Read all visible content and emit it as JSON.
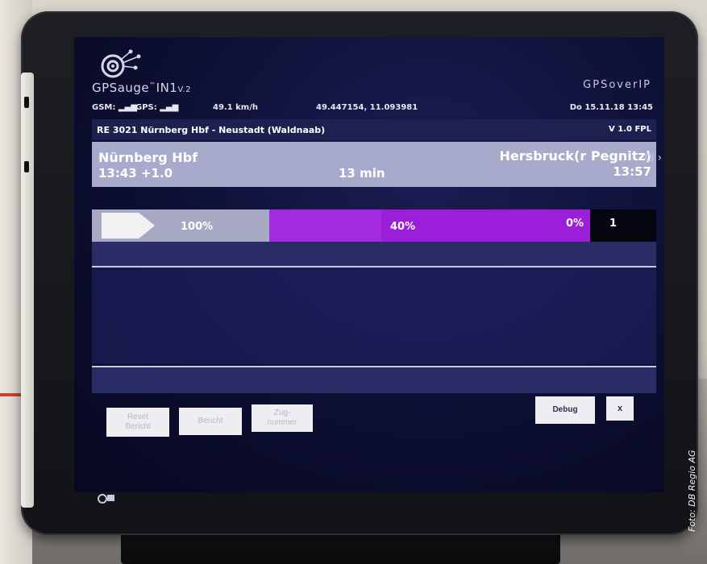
{
  "header": {
    "brand_left": "GPSauge",
    "brand_left_tm": "™",
    "brand_left_model": "IN1",
    "brand_left_version": "V.2",
    "brand_right": "GPSoverIP"
  },
  "statusbar": {
    "gsm": "GSM: ",
    "gps": "GPS: ",
    "speed": "49.1 km/h",
    "coords": "49.447154, 11.093981",
    "datetime": "Do 15.11.18  13:45"
  },
  "route": {
    "title": "RE 3021  Nürnberg Hbf - Neustadt (Waldnaab)",
    "version": "V 1.0 FPL"
  },
  "stop": {
    "from": "Nürnberg Hbf",
    "from_time": "13:43  +1.0",
    "duration": "13 min",
    "to": "Hersbruck(r Pegnitz)",
    "to_time": "13:57"
  },
  "progress": {
    "seg1_label": "100%",
    "seg2_label": "40%",
    "seg2_fraction": 0.4,
    "seg3_label": "0%",
    "count": "1"
  },
  "buttons": {
    "reset": "Reset\nBericht",
    "bericht": "Bericht",
    "zugnummer": "Zug-\nnummer",
    "debug": "Debug",
    "close": "x"
  },
  "icons": {
    "power": "power-icon",
    "chevron": "chevron-right-icon"
  },
  "credit": "Foto: DB Regio AG",
  "colors": {
    "screen_bg": "#0d0f33",
    "route_bar": "#1e2050",
    "stop_bar": "#a7aacb",
    "progress_done": "#a6a8c4",
    "progress_active": "#9b1fd8"
  }
}
